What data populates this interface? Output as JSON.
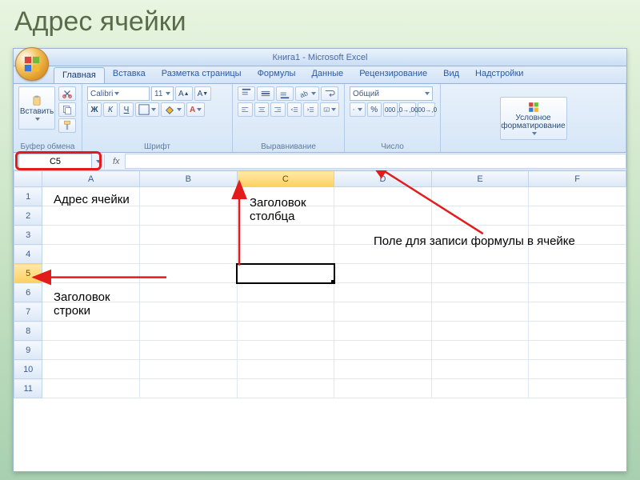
{
  "slide_title": "Адрес ячейки",
  "window_title": "Книга1 - Microsoft Excel",
  "tabs": [
    "Главная",
    "Вставка",
    "Разметка страницы",
    "Формулы",
    "Данные",
    "Рецензирование",
    "Вид",
    "Надстройки"
  ],
  "active_tab_index": 0,
  "ribbon": {
    "clipboard": {
      "paste": "Вставить",
      "label": "Буфер обмена"
    },
    "font": {
      "name": "Calibri",
      "size": "11",
      "bold": "Ж",
      "italic": "К",
      "underline": "Ч",
      "label": "Шрифт"
    },
    "align": {
      "label": "Выравнивание"
    },
    "number": {
      "format": "Общий",
      "label": "Число"
    },
    "styles": {
      "cond": "Условное форматирование"
    }
  },
  "name_box": "C5",
  "fx": "fx",
  "columns": [
    "A",
    "B",
    "C",
    "D",
    "E",
    "F"
  ],
  "rows": [
    "1",
    "2",
    "3",
    "4",
    "5",
    "6",
    "7",
    "8",
    "9",
    "10",
    "11"
  ],
  "selected": {
    "col": 2,
    "row": 4
  },
  "annotations": {
    "cell_addr": "Адрес ячейки",
    "col_head": "Заголовок столбца",
    "row_head": "Заголовок строки",
    "formula_field": "Поле для записи формулы в ячейке"
  }
}
